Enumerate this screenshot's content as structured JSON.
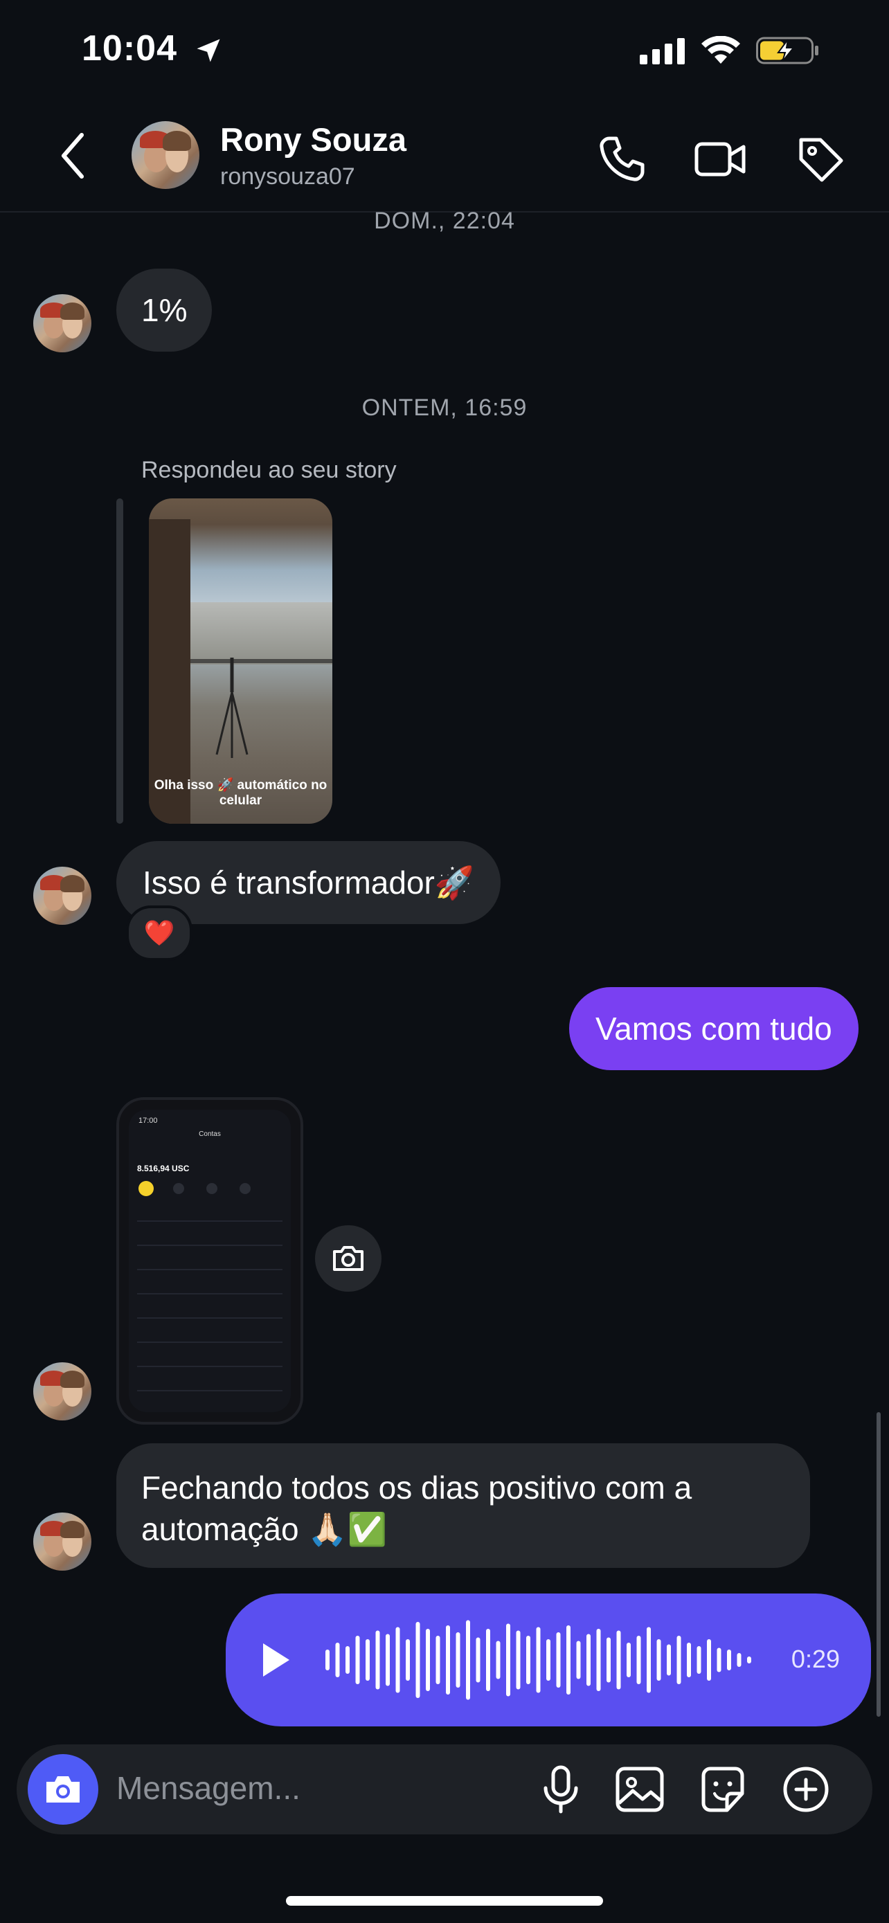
{
  "status_bar": {
    "time": "10:04"
  },
  "header": {
    "name": "Rony Souza",
    "username": "ronysouza07"
  },
  "timestamps": [
    "DOM., 22:04",
    "ONTEM, 16:59"
  ],
  "messages": {
    "percent": "1%",
    "reply_label": "Respondeu ao seu story",
    "story_caption": "Olha isso 🚀 automático no celular",
    "transformador": "Isso é transformador🚀",
    "reaction": "❤️",
    "vamos": "Vamos com tudo",
    "phone_shot": {
      "time": "17:00",
      "title": "Contas",
      "balance": "8.516,94 USC"
    },
    "fechando_line1": "Fechando todos os dias positivo com a",
    "fechando_line2": "automação 🙏🏻✅",
    "voice_duration": "0:29"
  },
  "composer": {
    "placeholder": "Mensagem..."
  },
  "icons": [
    "location-arrow-icon",
    "cellular-signal-icon",
    "wifi-icon",
    "battery-charging-icon",
    "back-chevron-icon",
    "phone-icon",
    "video-icon",
    "tag-icon",
    "camera-icon",
    "play-icon",
    "microphone-icon",
    "image-icon",
    "sticker-icon",
    "plus-icon"
  ],
  "colors": {
    "background": "#0c0f14",
    "incoming_bubble": "#25282d",
    "outgoing_bubble": "#7a40f2",
    "voice_bubble": "#5a4ff0",
    "camera_button": "#4f5bf6"
  }
}
